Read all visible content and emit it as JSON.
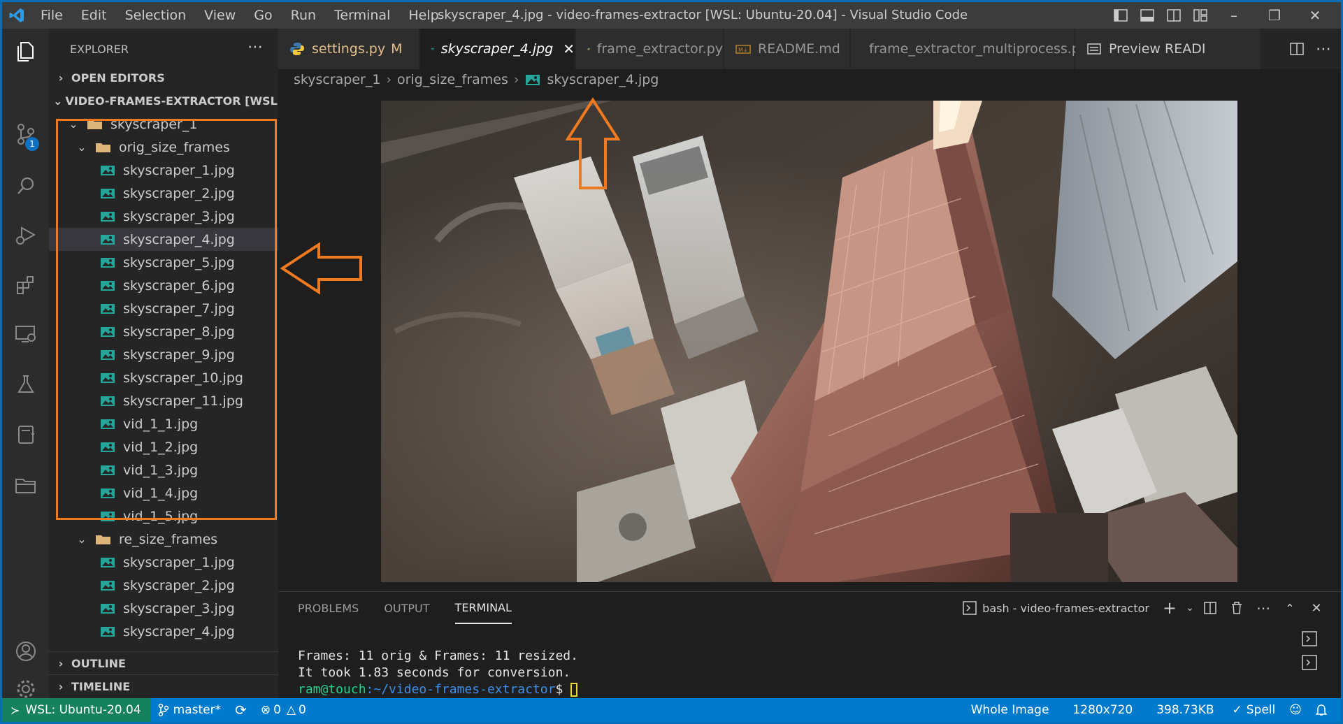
{
  "window": {
    "title": "skyscraper_4.jpg - video-frames-extractor [WSL: Ubuntu-20.04] - Visual Studio Code",
    "menu": [
      "File",
      "Edit",
      "Selection",
      "View",
      "Go",
      "Run",
      "Terminal",
      "Help"
    ],
    "accent_color": "#007acc",
    "remote_color": "#16825d",
    "highlight_color": "#f07a22"
  },
  "activity_bar": {
    "items": [
      "explorer-icon",
      "source-control-icon",
      "search-icon",
      "run-debug-icon",
      "extensions-icon",
      "remote-explorer-icon",
      "testing-icon",
      "notebook-icon",
      "folder-icon"
    ],
    "source_control_badge": "1",
    "bottom": [
      "account-icon",
      "settings-gear-icon"
    ]
  },
  "sidebar": {
    "title": "EXPLORER",
    "open_editors": "OPEN EDITORS",
    "workspace": "VIDEO-FRAMES-EXTRACTOR [WSL: ...",
    "root_folder": "skyscraper_1",
    "orig_folder": "orig_size_frames",
    "orig_files": [
      "skyscraper_1.jpg",
      "skyscraper_2.jpg",
      "skyscraper_3.jpg",
      "skyscraper_4.jpg",
      "skyscraper_5.jpg",
      "skyscraper_6.jpg",
      "skyscraper_7.jpg",
      "skyscraper_8.jpg",
      "skyscraper_9.jpg",
      "skyscraper_10.jpg",
      "skyscraper_11.jpg",
      "vid_1_1.jpg",
      "vid_1_2.jpg",
      "vid_1_3.jpg",
      "vid_1_4.jpg",
      "vid_1_5.jpg"
    ],
    "resize_folder": "re_size_frames",
    "resize_files": [
      "skyscraper_1.jpg",
      "skyscraper_2.jpg",
      "skyscraper_3.jpg",
      "skyscraper_4.jpg"
    ],
    "outline": "OUTLINE",
    "timeline": "TIMELINE"
  },
  "tabs": [
    {
      "label": "settings.py",
      "modified": "M",
      "icon": "python-icon"
    },
    {
      "label": "skyscraper_4.jpg",
      "icon": "image-icon"
    },
    {
      "label": "frame_extractor.py",
      "icon": "python-icon"
    },
    {
      "label": "README.md",
      "icon": "markdown-icon"
    },
    {
      "label": "frame_extractor_multiprocess.py",
      "icon": "python-icon"
    },
    {
      "label": "Preview READI",
      "icon": "preview-icon"
    }
  ],
  "breadcrumb": [
    "skyscraper_1",
    "orig_size_frames",
    "skyscraper_4.jpg"
  ],
  "panel": {
    "tabs": [
      "PROBLEMS",
      "OUTPUT",
      "TERMINAL"
    ],
    "terminal_name": "bash - video-frames-extractor",
    "lines": [
      "Frames: 11 orig & Frames: 11 resized.",
      "It took 1.83 seconds for conversion."
    ],
    "prompt_user": "ram@touch",
    "prompt_path": ":~/video-frames-extractor",
    "prompt_symbol": "$ "
  },
  "status": {
    "remote": "WSL: Ubuntu-20.04",
    "branch": "master*",
    "errors": "0",
    "warnings": "0",
    "zoom": "Whole Image",
    "dimensions": "1280x720",
    "size": "398.73KB",
    "spell": "Spell"
  }
}
